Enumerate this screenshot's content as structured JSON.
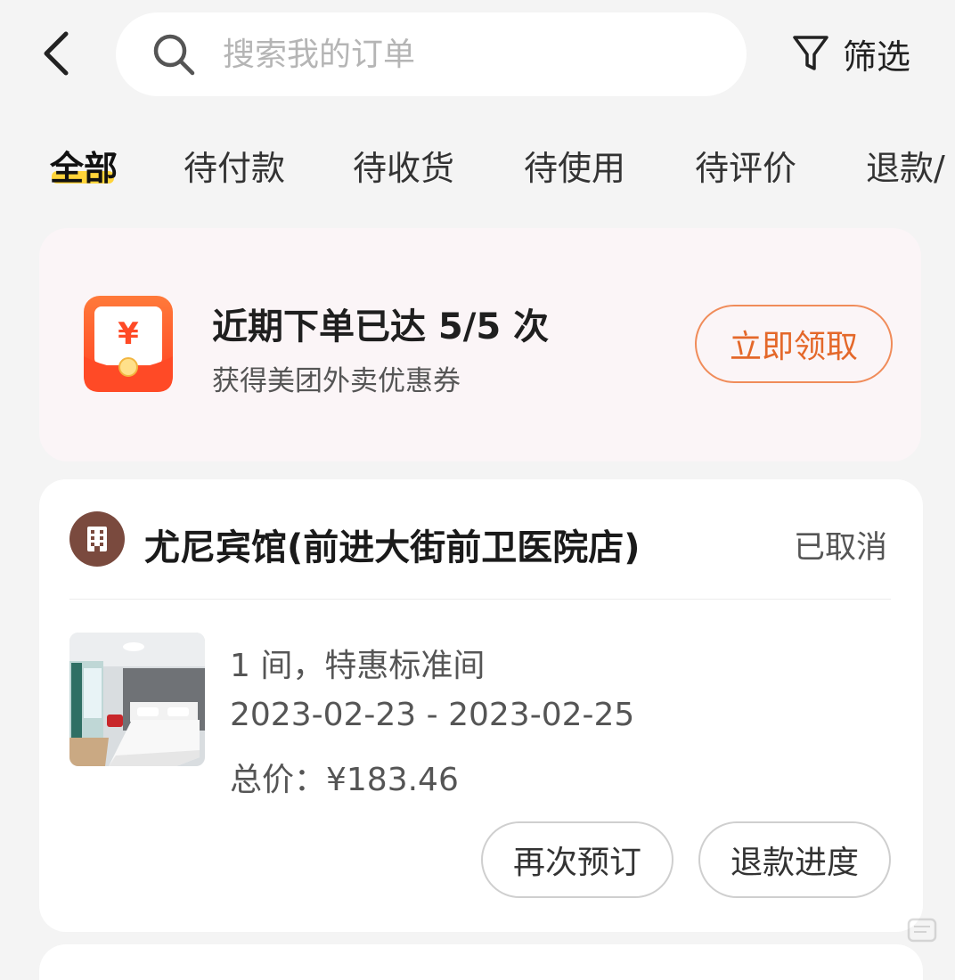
{
  "header": {
    "search_placeholder": "搜索我的订单",
    "filter_label": "筛选"
  },
  "tabs": [
    {
      "label": "全部",
      "active": true
    },
    {
      "label": "待付款"
    },
    {
      "label": "待收货"
    },
    {
      "label": "待使用"
    },
    {
      "label": "待评价"
    },
    {
      "label": "退款/"
    }
  ],
  "promo": {
    "icon": "red-envelope-yen-icon",
    "title": "近期下单已达 5/5 次",
    "subtitle": "获得美团外卖优惠券",
    "button_label": "立即领取",
    "accent_color": "#e4682a"
  },
  "order": {
    "hotel_icon": "building-icon",
    "hotel_name": "尤尼宾馆(前进大街前卫医院店)",
    "status": "已取消",
    "room_image": "hotel-room-photo",
    "room_desc": "1 间，特惠标准间",
    "dates": "2023-02-23  -  2023-02-25",
    "total_price": "总价：¥183.46",
    "buttons": {
      "rebook": "再次预订",
      "refund_progress": "退款进度"
    }
  },
  "colors": {
    "page_bg": "#f4f4f4",
    "tab_highlight": "#ffd43a",
    "promo_bg": "#fbf5f7",
    "status_text": "#555555"
  }
}
